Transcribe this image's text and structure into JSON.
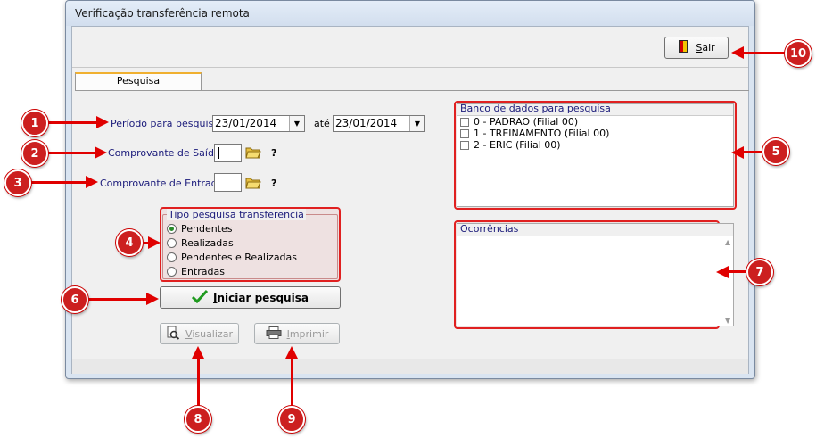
{
  "window": {
    "title": "Verificação transferência remota"
  },
  "toolbar": {
    "sair_label": "Sair",
    "sair_mnemonic": "S",
    "sair_rest": "air"
  },
  "tabs": [
    {
      "label": "Pesquisa"
    }
  ],
  "form": {
    "periodo_label": "Período para pesquisa:",
    "date_from": "23/01/2014",
    "ate_label": "até",
    "date_to": "23/01/2014",
    "saida_label": "Comprovante de Saída:",
    "entrada_label": "Comprovante de Entrada:",
    "question": "?"
  },
  "tipo_pesquisa": {
    "title": "Tipo pesquisa  transferencia",
    "options": [
      {
        "label": "Pendentes",
        "selected": true
      },
      {
        "label": "Realizadas",
        "selected": false
      },
      {
        "label": "Pendentes e Realizadas",
        "selected": false
      },
      {
        "label": "Entradas",
        "selected": false
      }
    ]
  },
  "buttons": {
    "iniciar_mnemonic": "I",
    "iniciar_rest": "niciar pesquisa",
    "visualizar_mnemonic": "V",
    "visualizar_rest": "isualizar",
    "imprimir_mnemonic": "I",
    "imprimir_rest": "mprimir"
  },
  "banco": {
    "title": "Banco de dados para pesquisa",
    "items": [
      {
        "label": "0 - PADRAO (Filial 00)"
      },
      {
        "label": "1 - TREINAMENTO (Filial 00)"
      },
      {
        "label": "2 - ERIC (Filial 00)"
      }
    ]
  },
  "ocorrencias": {
    "title": "Ocorrências"
  },
  "markers": [
    "1",
    "2",
    "3",
    "4",
    "5",
    "6",
    "7",
    "8",
    "9",
    "10"
  ],
  "colors": {
    "marker": "#cc1f1f",
    "arrow": "#e00000",
    "label_text": "#1a1a7a"
  }
}
